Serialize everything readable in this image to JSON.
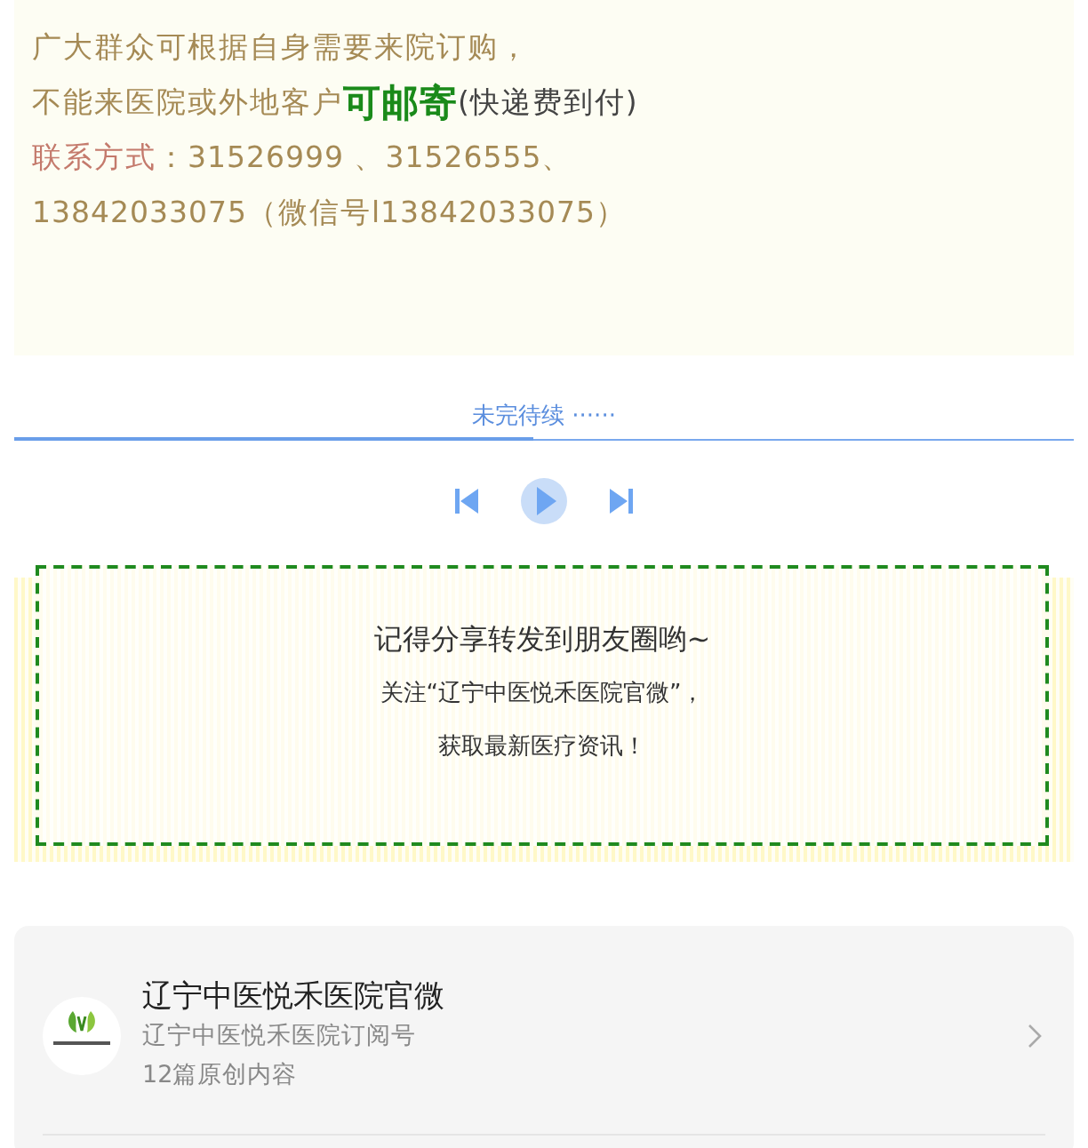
{
  "notice": {
    "lines": [
      [
        {
          "kind": "plain",
          "text": "广大群众可根据自身需要来院订购，"
        }
      ],
      [
        {
          "kind": "plain",
          "text": "不能来医院或外地客户"
        },
        {
          "kind": "highlight",
          "text": "可邮寄"
        },
        {
          "kind": "note",
          "text": "(快递费到付)"
        }
      ],
      [
        {
          "kind": "label",
          "text": "联系方式"
        },
        {
          "kind": "plain",
          "text": "：31526999 、31526555、"
        }
      ],
      [
        {
          "kind": "plain",
          "text": "13842033075（微信号l13842033075）"
        }
      ]
    ]
  },
  "continued": {
    "text": "未完待续 ······",
    "level": 0.49
  },
  "player": {
    "buttons": [
      {
        "kind": "previous"
      },
      {
        "kind": "play"
      },
      {
        "kind": "next"
      }
    ]
  },
  "share": {
    "lines": [
      {
        "kind": "large",
        "text": "记得分享转发到朋友圈哟~"
      },
      {
        "kind": "small",
        "text": "关注“辽宁中医悦禾医院官微”，"
      },
      {
        "kind": "small",
        "text": "获取最新医疗资讯！"
      }
    ]
  },
  "account": {
    "name": "辽宁中医悦禾医院官微",
    "type": "辽宁中医悦禾医院订阅号",
    "count": "12篇原创内容"
  }
}
